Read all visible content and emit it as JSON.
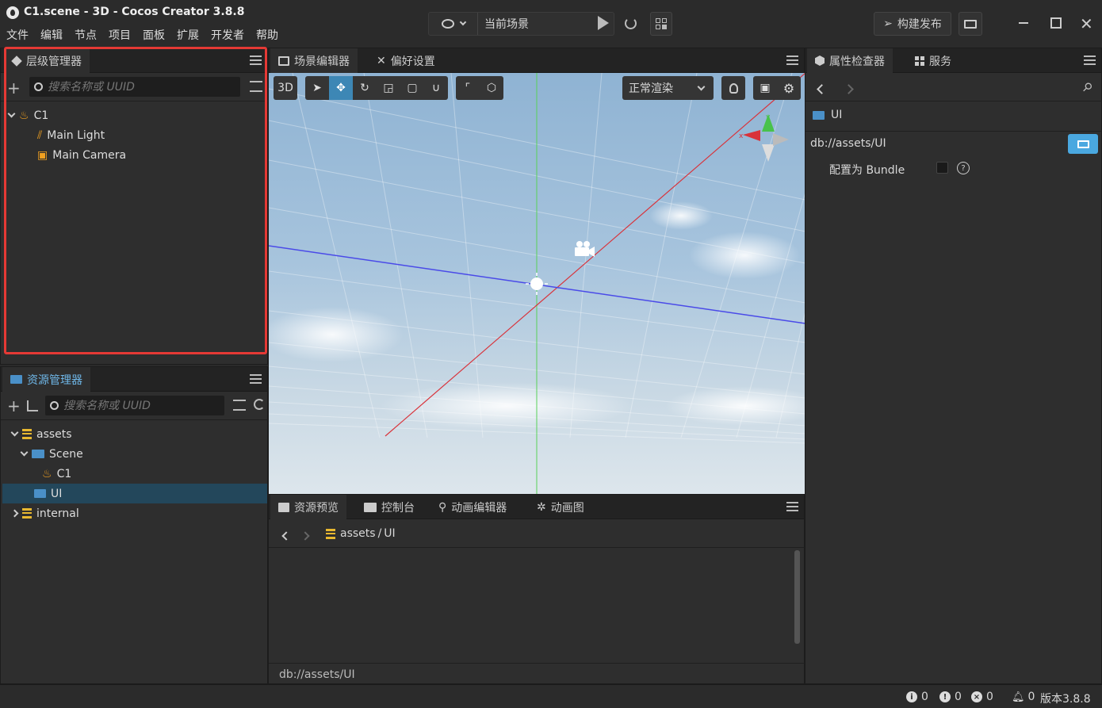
{
  "window": {
    "title": "C1.scene - 3D - Cocos Creator 3.8.8"
  },
  "menu": [
    "文件",
    "编辑",
    "节点",
    "项目",
    "面板",
    "扩展",
    "开发者",
    "帮助"
  ],
  "toolbar": {
    "scene_select": "当前场景",
    "build_label": "构建发布"
  },
  "hierarchy": {
    "tab": "层级管理器",
    "search_placeholder": "搜索名称或 UUID",
    "nodes": [
      {
        "label": "C1"
      },
      {
        "label": "Main Light"
      },
      {
        "label": "Main Camera"
      }
    ]
  },
  "assets": {
    "tab": "资源管理器",
    "search_placeholder": "搜索名称或 UUID",
    "items": [
      {
        "label": "assets"
      },
      {
        "label": "Scene"
      },
      {
        "label": "C1"
      },
      {
        "label": "UI"
      },
      {
        "label": "internal"
      }
    ]
  },
  "scene": {
    "tabs": [
      "场景编辑器",
      "偏好设置"
    ],
    "mode_3d": "3D",
    "render_mode": "正常渲染",
    "gizmo_labels": {
      "x": "x",
      "y": "y"
    }
  },
  "bottom": {
    "tabs": [
      "资源预览",
      "控制台",
      "动画编辑器",
      "动画图"
    ],
    "breadcrumb_root": "assets",
    "breadcrumb_sep": "/",
    "breadcrumb_leaf": "UI",
    "footer_path": "db://assets/UI"
  },
  "inspector": {
    "tabs": [
      "属性检查器",
      "服务"
    ],
    "asset_name": "UI",
    "asset_path": "db://assets/UI",
    "bundle_label": "配置为 Bundle",
    "bundle_checked": false
  },
  "status": {
    "info_count": "0",
    "warn_count": "0",
    "error_count": "0",
    "notify_count": "0",
    "version": "版本3.8.8"
  },
  "colors": {
    "accent": "#3d87b5",
    "highlight_border": "#e53935",
    "selected_row": "#23475b",
    "folder": "#4a90c8",
    "scene_icon": "#f0a020"
  }
}
